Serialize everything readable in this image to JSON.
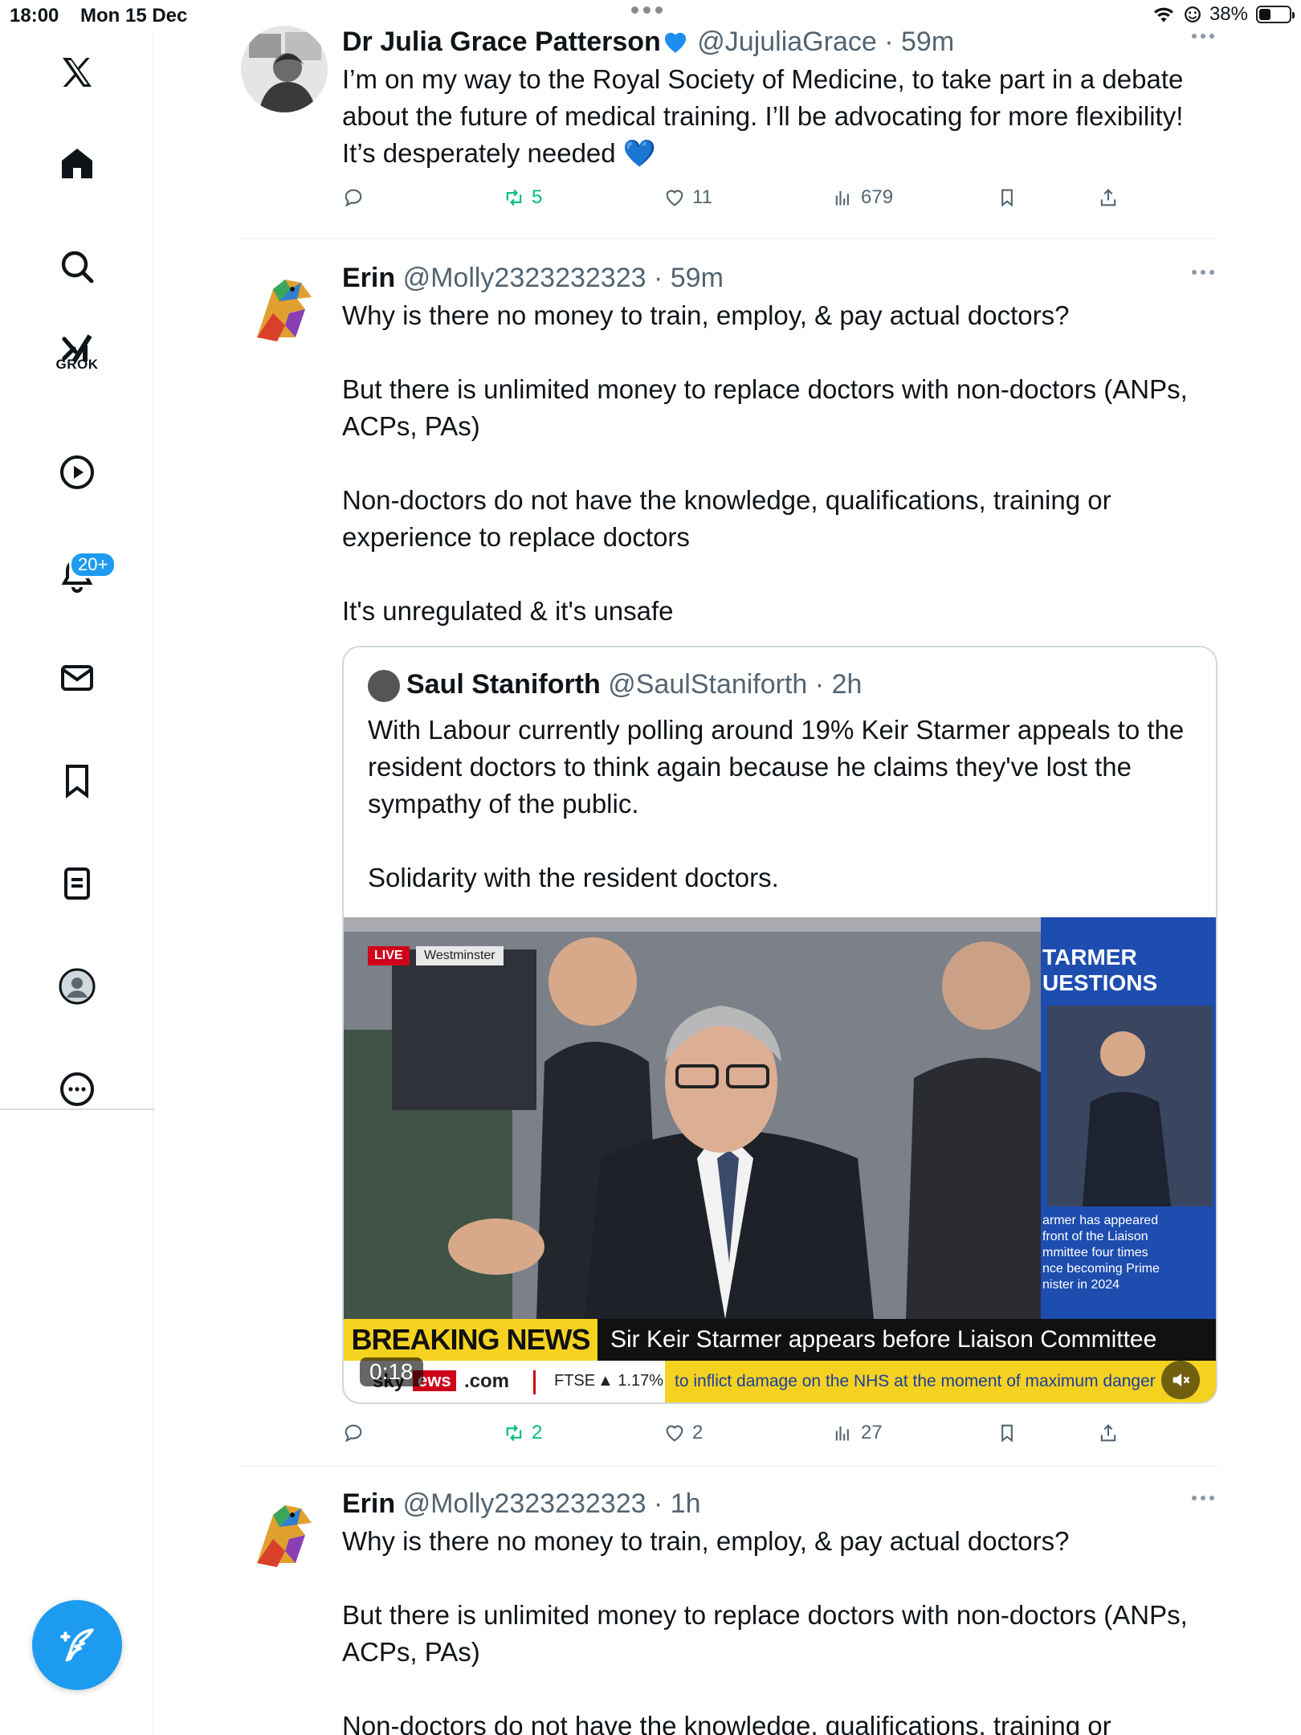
{
  "status": {
    "time": "18:00",
    "date": "Mon 15 Dec",
    "battery": "38%",
    "battery_level": 0.38
  },
  "sidebar": {
    "grok_label": "GROK",
    "notification_count": "20+"
  },
  "tweets": [
    {
      "name": "Dr Julia Grace Patterson",
      "handle": "@JujuliaGrace",
      "time": "59m",
      "text": "I’m on my way to the Royal Society of Medicine, to take part in a debate about the future of medical training. I’ll be advocating for more flexibility! It’s desperately needed 💙",
      "reposts": "5",
      "likes": "11",
      "views": "679"
    },
    {
      "name": "Erin",
      "handle": "@Molly2323232323",
      "time": "59m",
      "text": "Why is there no money to train, employ, & pay actual doctors?\n\nBut there is unlimited money to replace doctors with non-doctors (ANPs, ACPs, PAs)\n\nNon-doctors do not have the knowledge, qualifications, training or experience to replace doctors\n\nIt's unregulated & it's unsafe",
      "reposts": "2",
      "likes": "2",
      "views": "27",
      "quote": {
        "name": "Saul Staniforth",
        "handle": "@SaulStaniforth",
        "time": "2h",
        "text": "With Labour currently polling around 19% Keir Starmer appeals to the resident doctors to think again because he claims they've lost the sympathy of the public.\n\nSolidarity with the resident doctors.",
        "video": {
          "live": "LIVE",
          "location": "Westminster",
          "side_title": "TARMER\nUESTIONS",
          "side_caption": "armer has appeared\nfront of the Liaison\nmmittee four times\nnce becoming Prime\nnister in 2024",
          "breaking": "BREAKING NEWS",
          "headline": "Sir Keir Starmer appears before Liaison Committee",
          "duration": "0:18",
          "site_a": "ews",
          "site_b": ".com",
          "ticker_index": "FTSE",
          "ticker_value": "▲ 1.17%",
          "ticker_text": "to inflict damage on the NHS at the moment of maximum danger"
        }
      }
    },
    {
      "name": "Erin",
      "handle": "@Molly2323232323",
      "time": "1h",
      "text": "Why is there no money to train, employ, & pay actual doctors?\n\nBut there is unlimited money to replace doctors with non-doctors (ANPs, ACPs, PAs)\n\nNon-doctors do not have the knowledge, qualifications, training or"
    }
  ],
  "colors": {
    "accent": "#1d9bf0",
    "repost_green": "#00ba7c",
    "muted": "#536471",
    "breaking_yellow": "#f5d21f"
  }
}
